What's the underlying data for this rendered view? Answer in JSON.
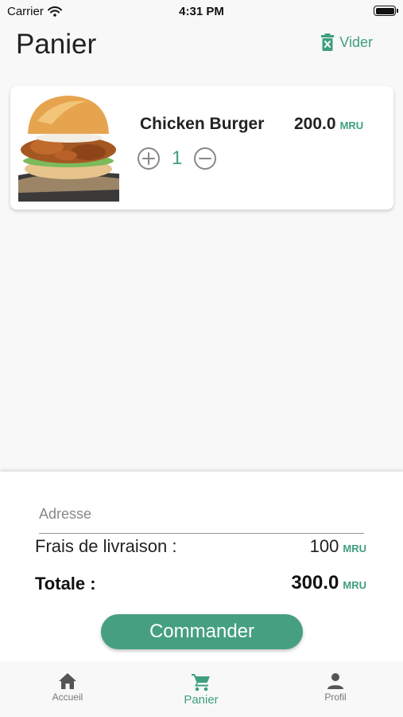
{
  "status_bar": {
    "carrier": "Carrier",
    "time": "4:31 PM"
  },
  "header": {
    "title": "Panier",
    "clear_label": "Vider"
  },
  "cart_items": [
    {
      "name": "Chicken Burger",
      "price": "200.0",
      "currency": "MRU",
      "quantity": "1"
    }
  ],
  "checkout": {
    "address_placeholder": "Adresse",
    "delivery_label": "Frais de livraison :",
    "delivery_value": "100",
    "delivery_currency": "MRU",
    "total_label": "Totale :",
    "total_value": "300.0",
    "total_currency": "MRU",
    "order_button": "Commander"
  },
  "tabs": [
    {
      "label": "Accueil",
      "icon": "home-icon",
      "active": false
    },
    {
      "label": "Panier",
      "icon": "cart-icon",
      "active": true
    },
    {
      "label": "Profil",
      "icon": "person-icon",
      "active": false
    }
  ],
  "colors": {
    "accent": "#3f9f7f",
    "button": "#459f80"
  }
}
